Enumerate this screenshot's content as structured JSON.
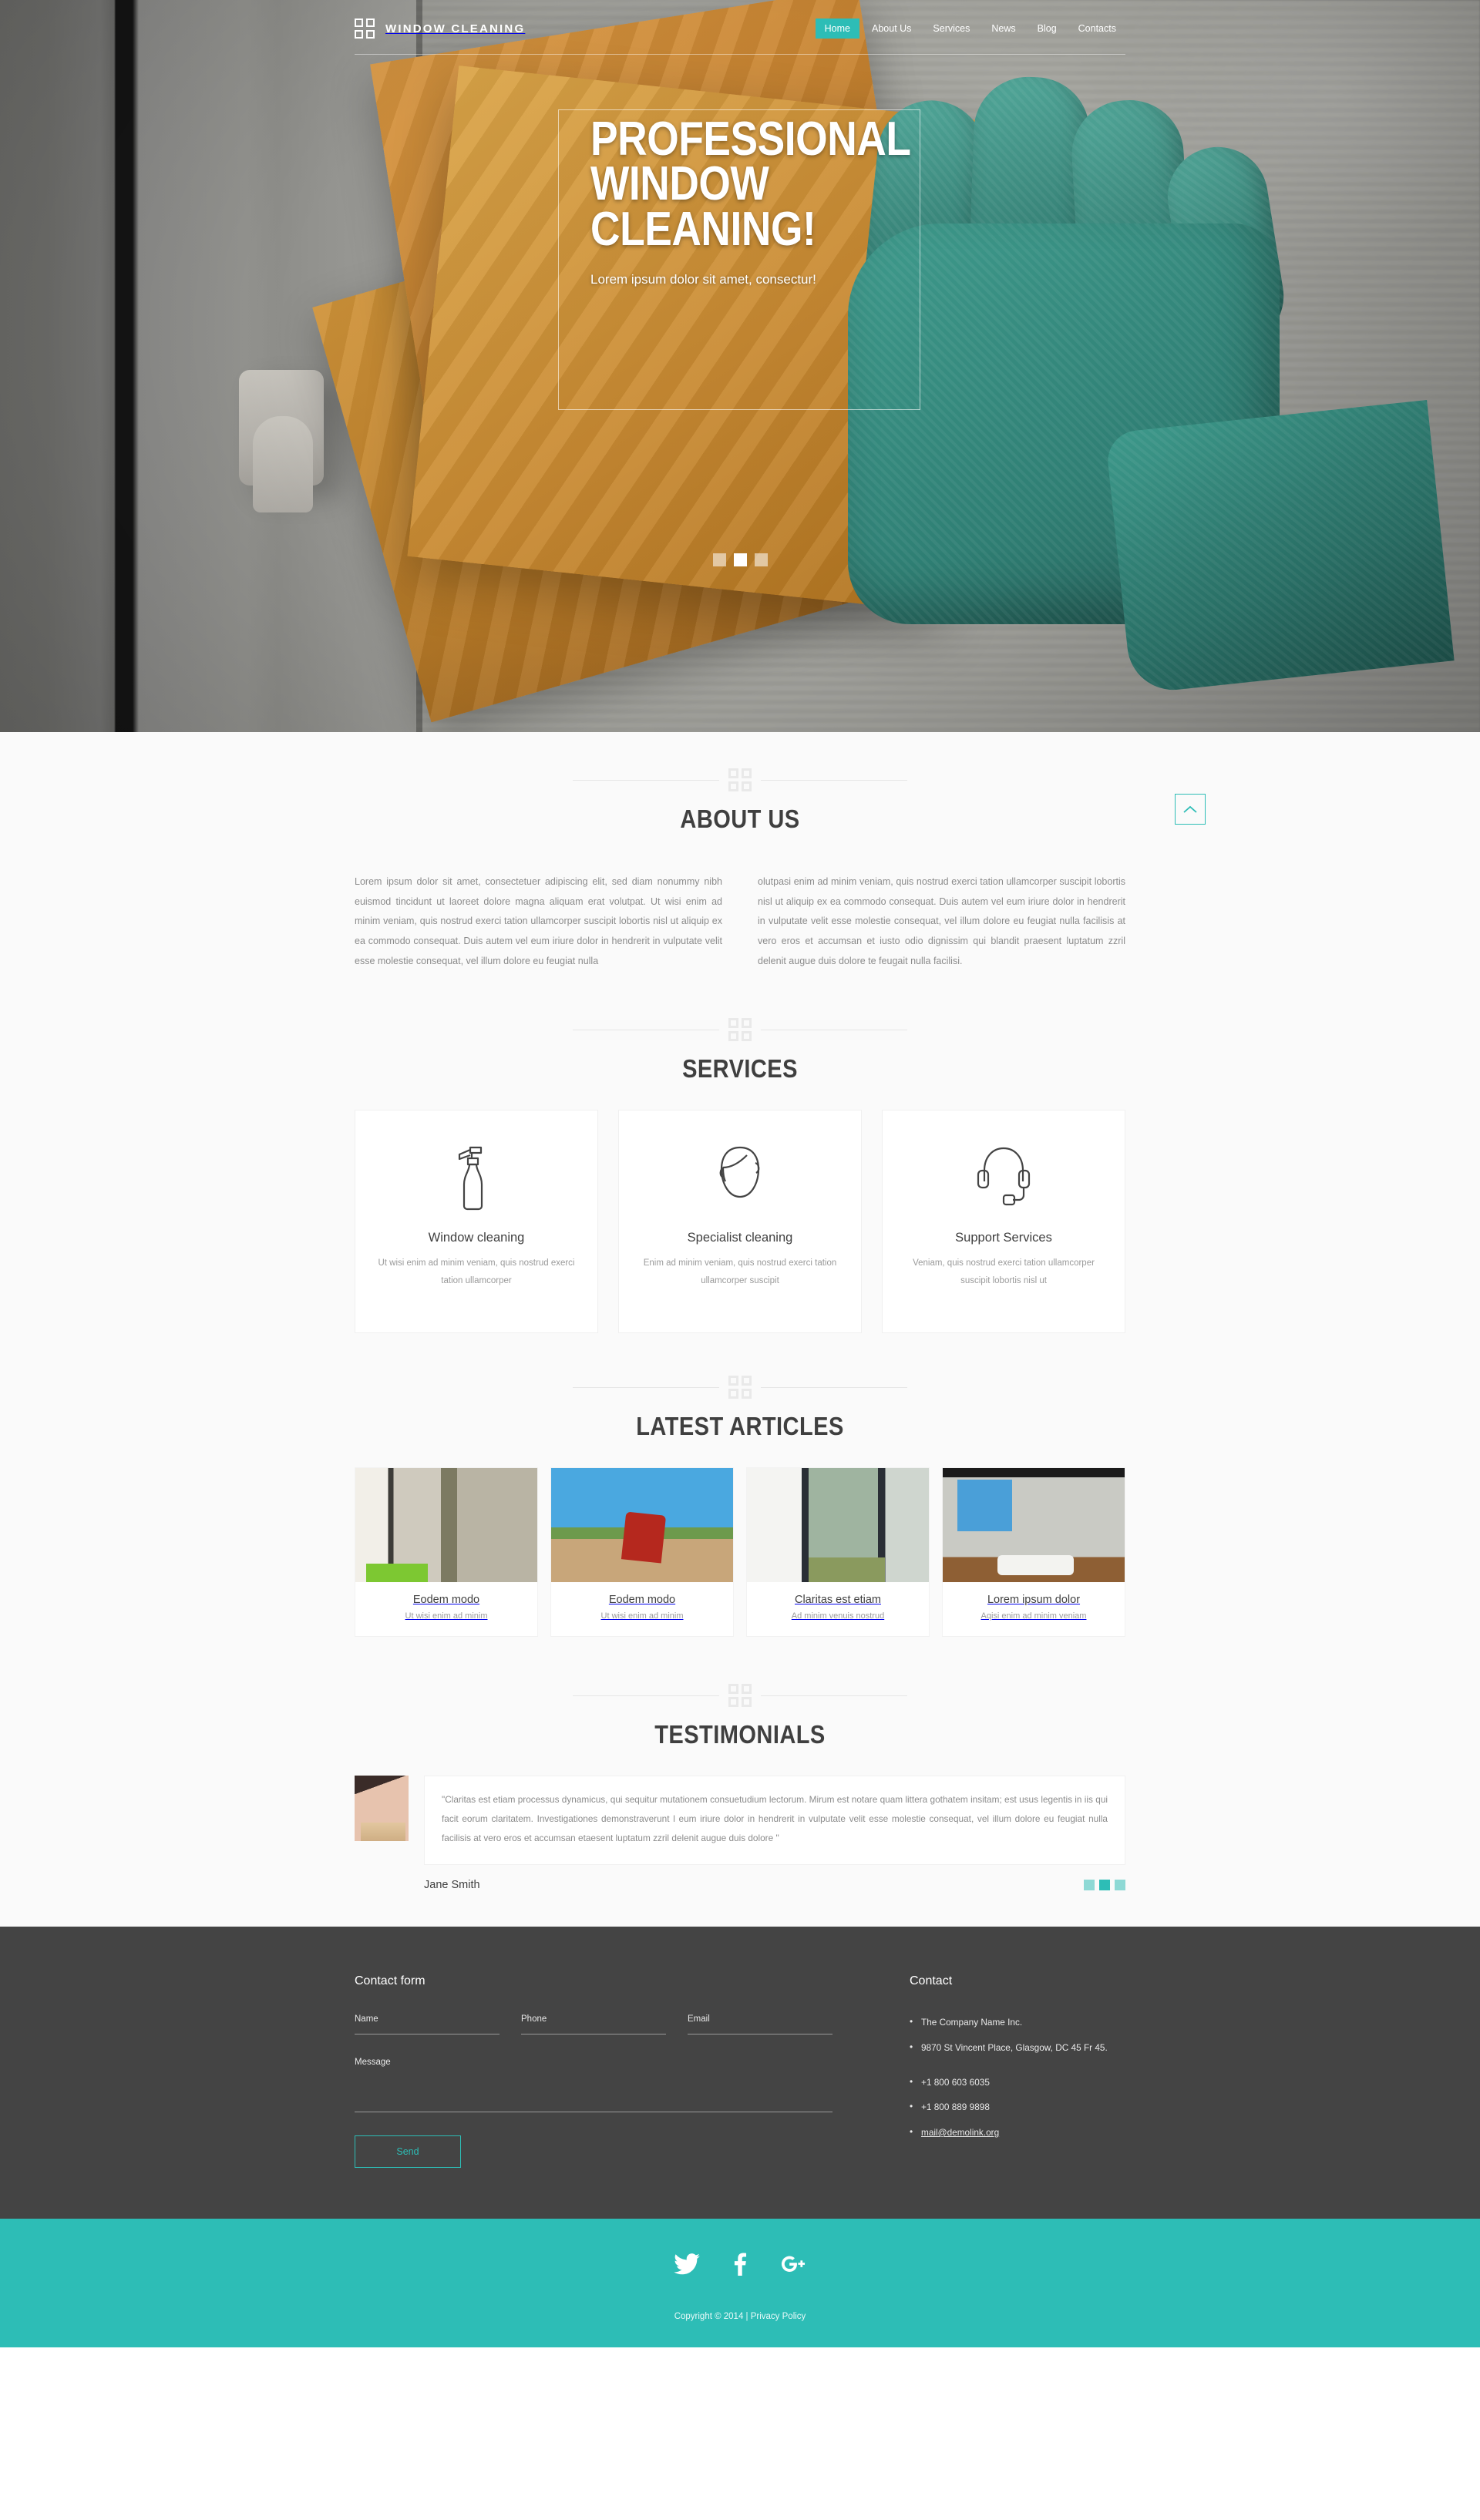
{
  "header": {
    "brand": "WINDOW CLEANING",
    "logo_icon": "four-square-grid-icon",
    "nav": [
      {
        "label": "Home",
        "active": true
      },
      {
        "label": "About Us",
        "active": false
      },
      {
        "label": "Services",
        "active": false
      },
      {
        "label": "News",
        "active": false
      },
      {
        "label": "Blog",
        "active": false
      },
      {
        "label": "Contacts",
        "active": false
      }
    ]
  },
  "hero": {
    "title_line1": "PROFESSIONAL",
    "title_line2": "WINDOW",
    "title_line3": "CLEANING!",
    "subtitle": "Lorem ipsum dolor sit amet, consectur!",
    "slides": [
      {
        "active": false
      },
      {
        "active": true
      },
      {
        "active": false
      }
    ]
  },
  "about": {
    "title": "ABOUT US",
    "col1": "Lorem ipsum dolor sit amet, consectetuer adipiscing elit, sed diam nonummy nibh euismod tincidunt ut laoreet dolore magna aliquam erat volutpat. Ut wisi enim ad minim veniam, quis nostrud exerci tation ullamcorper suscipit lobortis nisl ut aliquip ex ea commodo consequat. Duis autem vel eum iriure dolor in hendrerit in vulputate velit esse molestie consequat, vel illum dolore eu feugiat nulla",
    "col2": "olutpasi enim ad minim veniam, quis nostrud exerci tation ullamcorper suscipit lobortis nisl ut aliquip ex ea commodo consequat. Duis autem vel eum iriure dolor in hendrerit in vulputate velit esse molestie consequat, vel illum dolore eu feugiat nulla facilisis at vero eros et accumsan et iusto odio dignissim qui blandit praesent luptatum zzril delenit augue duis dolore te feugait nulla facilisi."
  },
  "services": {
    "title": "SERVICES",
    "items": [
      {
        "icon": "spray-bottle-icon",
        "name": "Window cleaning",
        "desc": "Ut wisi enim ad minim veniam, quis nostrud exerci tation ullamcorper"
      },
      {
        "icon": "head-profile-icon",
        "name": "Specialist cleaning",
        "desc": "Enim ad minim veniam, quis nostrud exerci tation ullamcorper suscipit"
      },
      {
        "icon": "headset-icon",
        "name": "Support Services",
        "desc": "Veniam, quis nostrud exerci tation ullamcorper suscipit lobortis nisl ut"
      }
    ]
  },
  "articles": {
    "title": "LATEST ARTICLES",
    "items": [
      {
        "title": "Eodem modo",
        "sub": "Ut wisi enim ad minim"
      },
      {
        "title": "Eodem modo",
        "sub": "Ut wisi enim ad minim"
      },
      {
        "title": "Claritas est etiam",
        "sub": "Ad minim venuis nostrud"
      },
      {
        "title": "Lorem ipsum dolor",
        "sub": "Aqisi enim ad minim veniam"
      }
    ]
  },
  "testimonials": {
    "title": "TESTIMONIALS",
    "quote": "\"Claritas est etiam processus dynamicus, qui sequitur mutationem consuetudium lectorum. Mirum est notare quam littera gothatem insitam; est usus legentis in iis qui facit eorum claritatem. Investigationes demonstraverunt l eum iriure dolor in hendrerit in vulputate velit esse molestie consequat, vel illum dolore eu feugiat nulla facilisis at vero eros et accumsan etaesent luptatum zzril delenit augue duis dolore  \"",
    "author": "Jane Smith",
    "dots": [
      {
        "active": false
      },
      {
        "active": true
      },
      {
        "active": false
      }
    ]
  },
  "to_top": {
    "icon": "chevron-up-icon"
  },
  "footer": {
    "form_title": "Contact form",
    "fields": [
      {
        "label": "Name",
        "value": "",
        "placeholder": "Name"
      },
      {
        "label": "Phone",
        "value": "",
        "placeholder": "Phone"
      },
      {
        "label": "Email",
        "value": "",
        "placeholder": "Email"
      }
    ],
    "message_label": "Message",
    "message_value": "",
    "send_label": "Send",
    "contact_title": "Contact",
    "contact_items": [
      "The Company Name Inc.",
      "9870 St Vincent Place, Glasgow, DC 45 Fr 45.",
      "+1 800 603 6035",
      "+1 800 889 9898"
    ],
    "email_link": "mail@demolink.org"
  },
  "social": {
    "links": [
      {
        "name": "twitter-icon",
        "label": "Twitter"
      },
      {
        "name": "facebook-icon",
        "label": "Facebook"
      },
      {
        "name": "google-plus-icon",
        "label": "Google Plus"
      }
    ],
    "copyright": "Copyright © 2014 | Privacy Policy"
  },
  "colors": {
    "accent": "#2dbdb6",
    "accent_light": "#8ed9d5",
    "footer_bg": "#444444",
    "section_bg": "#fafafa",
    "heading": "#3f3f3f"
  }
}
